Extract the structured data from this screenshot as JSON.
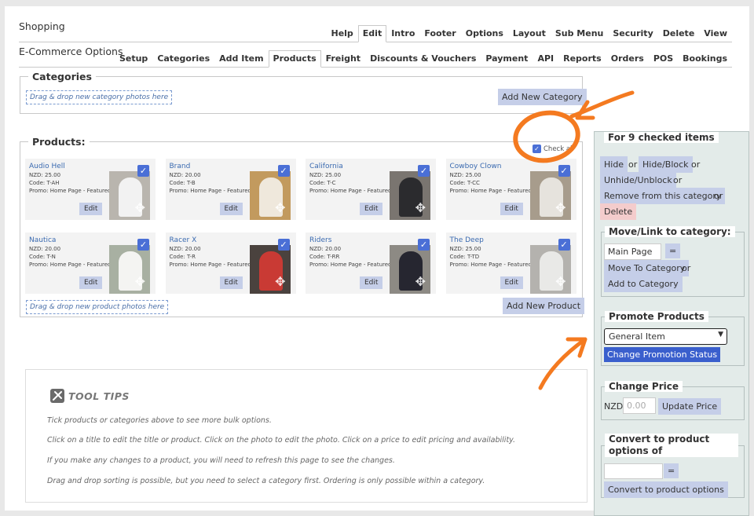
{
  "top_nav": {
    "label": "Shopping",
    "tabs": [
      "Help",
      "Edit",
      "Intro",
      "Footer",
      "Options",
      "Layout",
      "Sub Menu",
      "Security",
      "Delete",
      "View"
    ],
    "active": "Edit"
  },
  "sub_nav": {
    "label": "E-Commerce Options",
    "tabs": [
      "Setup",
      "Categories",
      "Add Item",
      "Products",
      "Freight",
      "Discounts & Vouchers",
      "Payment",
      "API",
      "Reports",
      "Orders",
      "POS",
      "Bookings"
    ],
    "active": "Products"
  },
  "categories": {
    "title": "Categories",
    "dropzone": "Drag & drop new category photos here",
    "add_button": "Add New Category"
  },
  "products": {
    "title": "Products:",
    "check_all": "Check all",
    "edit_label": "Edit",
    "dropzone": "Drag & drop new product photos here",
    "add_button": "Add New Product",
    "items": [
      {
        "name": "Audio Hell",
        "price": "NZD: 25.00",
        "code": "Code: T-AH",
        "promo": "Promo: Home Page - Featured",
        "checked": true,
        "bg": "#b9b5ae",
        "shirt": "#f2f2f2"
      },
      {
        "name": "Brand",
        "price": "NZD: 20.00",
        "code": "Code: T-B",
        "promo": "Promo: Home Page - Featured",
        "checked": true,
        "bg": "#c29a5e",
        "shirt": "#efe8dc"
      },
      {
        "name": "California",
        "price": "NZD: 25.00",
        "code": "Code: T-C",
        "promo": "Promo: Home Page - Featured",
        "checked": true,
        "bg": "#7a7570",
        "shirt": "#2b2b2e"
      },
      {
        "name": "Cowboy Clown",
        "price": "NZD: 25.00",
        "code": "Code: T-CC",
        "promo": "Promo: Home Page - Featured",
        "checked": true,
        "bg": "#a79c8c",
        "shirt": "#e6e3dd"
      },
      {
        "name": "Nautica",
        "price": "NZD: 20.00",
        "code": "Code: T-N",
        "promo": "Promo: Home Page - Featured",
        "checked": true,
        "bg": "#a8b0a2",
        "shirt": "#f4f4f2"
      },
      {
        "name": "Racer X",
        "price": "NZD: 20.00",
        "code": "Code: T-R",
        "promo": "Promo: Home Page - Featured",
        "checked": true,
        "bg": "#4a423e",
        "shirt": "#c93a34"
      },
      {
        "name": "Riders",
        "price": "NZD: 20.00",
        "code": "Code: T-RR",
        "promo": "Promo: Home Page - Featured",
        "checked": true,
        "bg": "#8d8a84",
        "shirt": "#262630"
      },
      {
        "name": "The Deep",
        "price": "NZD: 25.00",
        "code": "Code: T-TD",
        "promo": "Promo: Home Page - Featured",
        "checked": true,
        "bg": "#b4b2ae",
        "shirt": "#e9e9e7"
      }
    ]
  },
  "tool_tips": {
    "title": "TOOL TIPS",
    "lines": [
      "Tick products or categories above to see more bulk options.",
      "Click on a title to edit the title or product. Click on the photo to edit the photo. Click on a price to edit pricing and availability.",
      "If you make any changes to a product, you will need to refresh this page to see the changes.",
      "Drag and drop sorting is possible, but you need to select a category first. Ordering is only possible within a category."
    ]
  },
  "bulk": {
    "title": "For 9 checked items",
    "or": "or",
    "hide": "Hide",
    "hide_block": "Hide/Block",
    "unhide": "Unhide/Unblock",
    "remove": "Remove from this category",
    "delete": "Delete",
    "move_title": "Move/Link to category:",
    "category_value": "Main Page",
    "equals": "=",
    "move_button": "Move To Category",
    "add_button": "Add to Category",
    "promote_title": "Promote Products",
    "promote_value": "General Item",
    "promote_button": "Change Promotion Status",
    "price_title": "Change Price",
    "currency": "NZD",
    "price_placeholder": "0.00",
    "price_button": "Update Price",
    "convert_title": "Convert to product options of",
    "convert_button": "Convert to product options"
  },
  "colors": {
    "button": "#c5cee8",
    "primary_button": "#3a5fcd",
    "delete_button": "#f4cccc",
    "checkbox": "#4a6fd6",
    "annotation": "#f47a20",
    "side_panel": "#e3ebe9"
  }
}
